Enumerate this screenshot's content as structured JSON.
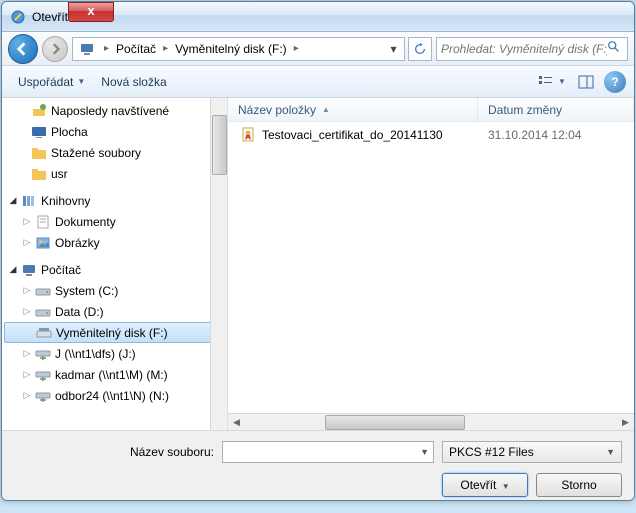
{
  "window": {
    "title": "Otevřít"
  },
  "breadcrumb": {
    "seg1": "Počítač",
    "seg2": "Vyměnitelný disk (F:)"
  },
  "search": {
    "placeholder": "Prohledat: Vyměnitelný disk (F:)"
  },
  "toolbar": {
    "organize": "Uspořádat",
    "newfolder": "Nová složka"
  },
  "tree": {
    "recent": "Naposledy navštívené",
    "desktop": "Plocha",
    "downloads": "Stažené soubory",
    "usr": "usr",
    "libraries": "Knihovny",
    "documents": "Dokumenty",
    "pictures": "Obrázky",
    "computer": "Počítač",
    "driveC": "System (C:)",
    "driveD": "Data (D:)",
    "driveF": "Vyměnitelný disk (F:)",
    "netJ": "J (\\\\nt1\\dfs) (J:)",
    "netM": "kadmar (\\\\nt1\\M) (M:)",
    "netN": "odbor24 (\\\\nt1\\N) (N:)"
  },
  "columns": {
    "name": "Název položky",
    "date": "Datum změny"
  },
  "files": [
    {
      "name": "Testovaci_certifikat_do_20141130",
      "date": "31.10.2014 12:04"
    }
  ],
  "footer": {
    "filename_label": "Název souboru:",
    "filetype": "PKCS #12 Files",
    "open": "Otevřít",
    "cancel": "Storno"
  }
}
